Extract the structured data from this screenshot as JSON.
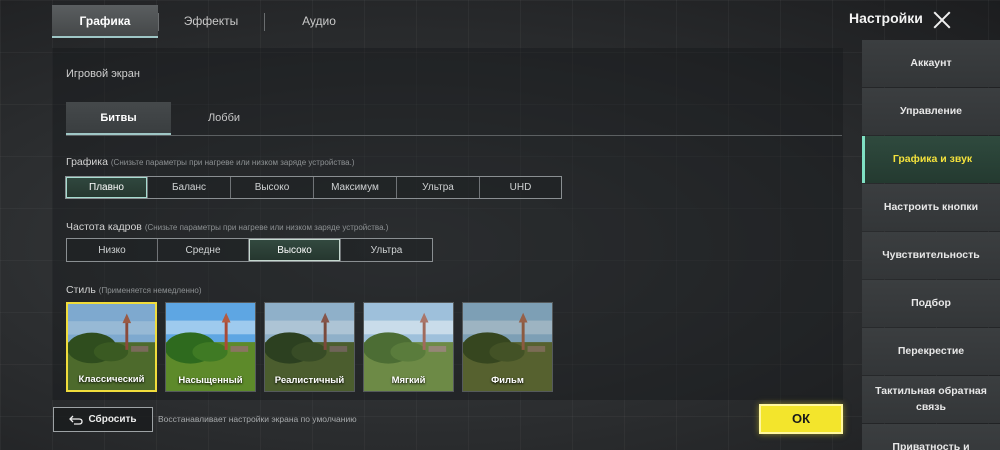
{
  "title": "Настройки",
  "top_tabs": [
    "Графика",
    "Эффекты",
    "Аудио"
  ],
  "section_title": "Игровой экран",
  "sub_tabs": [
    "Битвы",
    "Лобби"
  ],
  "graphics": {
    "label": "Графика",
    "hint": "(Снизьте параметры при нагреве или низком заряде устройства.)",
    "options": [
      "Плавно",
      "Баланс",
      "Высоко",
      "Максимум",
      "Ультра",
      "UHD"
    ],
    "selected": "Плавно"
  },
  "fps": {
    "label": "Частота кадров",
    "hint": "(Снизьте параметры при нагреве или низком заряде устройства.)",
    "options": [
      "Низко",
      "Средне",
      "Высоко",
      "Ультра"
    ],
    "selected": "Высоко"
  },
  "style": {
    "label": "Стиль",
    "hint": "(Применяется немедленно)",
    "options": [
      "Классический",
      "Насыщенный",
      "Реалистичный",
      "Мягкий",
      "Фильм"
    ],
    "selected": "Классический"
  },
  "reset": {
    "label": "Сбросить",
    "hint": "Восстанавливает настройки экрана по умолчанию"
  },
  "ok_label": "ОК",
  "sidebar": [
    "Аккаунт",
    "Управление",
    "Графика и звук",
    "Настроить кнопки",
    "Чувствительность",
    "Подбор",
    "Перекрестие",
    "Тактильная обратная связь",
    "Приватность и"
  ],
  "sidebar_active": "Графика и звук",
  "colors": {
    "accent_teal": "#9fc7c6",
    "ok_yellow": "#f3e52c",
    "selected_style_border": "#f0dc3c",
    "sidebar_active_text": "#f4e23c"
  }
}
